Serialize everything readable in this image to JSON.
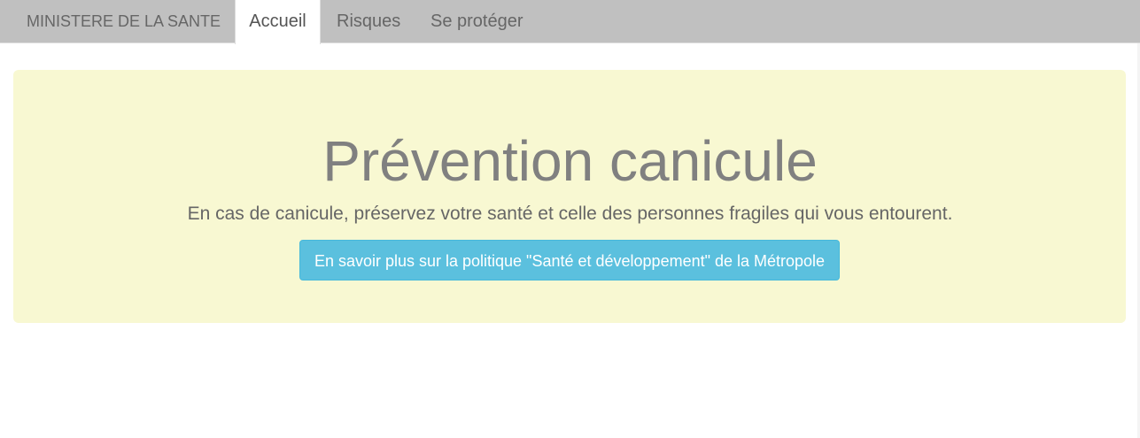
{
  "navbar": {
    "brand": "MINISTERE DE LA SANTE",
    "tabs": [
      {
        "label": "Accueil",
        "active": true
      },
      {
        "label": "Risques",
        "active": false
      },
      {
        "label": "Se protéger",
        "active": false
      }
    ]
  },
  "hero": {
    "title": "Prévention canicule",
    "subtitle": "En cas de canicule, préservez votre santé et celle des personnes fragiles qui vous entourent.",
    "button_label": "En savoir plus sur la politique \"Santé et développement\" de la Métropole"
  },
  "colors": {
    "navbar_bg": "#c0c0c0",
    "hero_bg": "#f8f8d2",
    "button_bg": "#5bc0de",
    "title_text": "#808080"
  }
}
